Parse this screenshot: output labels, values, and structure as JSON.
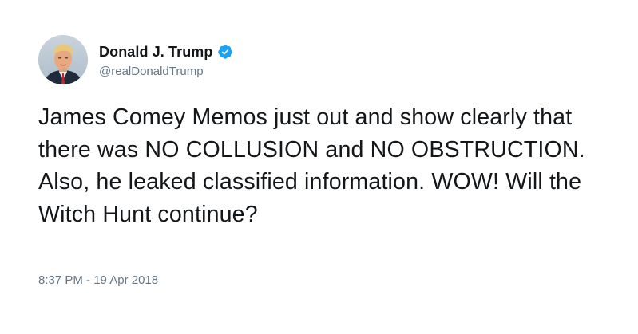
{
  "tweet": {
    "author": {
      "display_name": "Donald J. Trump",
      "handle": "@realDonaldTrump",
      "verified": true,
      "avatar_icon": "profile-photo",
      "verified_icon": "verified-badge-icon",
      "verified_color": "#1da1f2"
    },
    "text": "James Comey Memos just out and show clearly that there was NO COLLUSION and NO OBSTRUCTION. Also, he leaked classified information. WOW! Will the Witch Hunt continue?",
    "timestamp": "8:37 PM - 19 Apr 2018"
  },
  "colors": {
    "text_primary": "#14171a",
    "text_secondary": "#657786",
    "background": "#ffffff"
  }
}
